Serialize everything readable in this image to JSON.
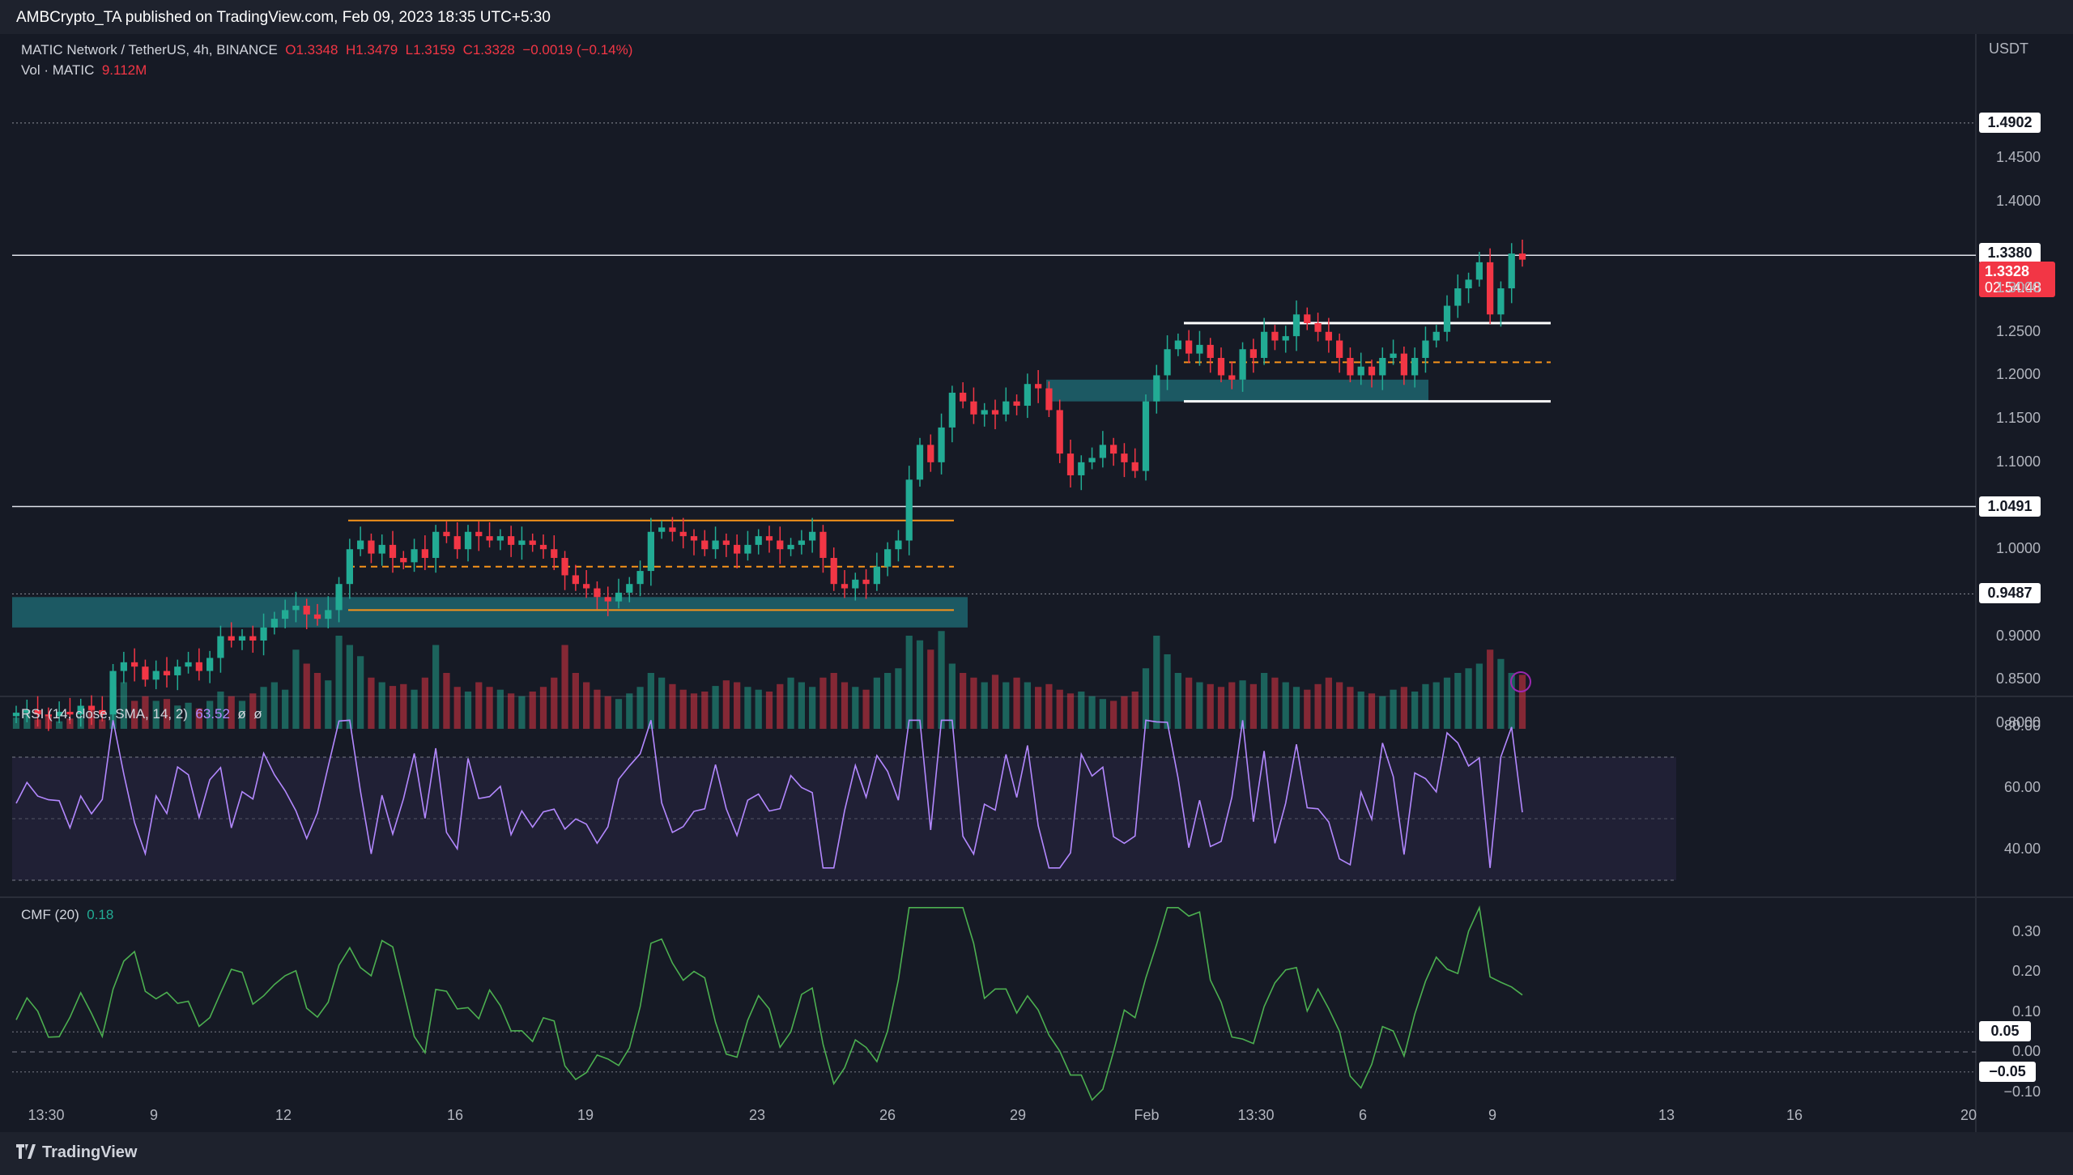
{
  "header": {
    "publisher_line": "AMBCrypto_TA published on TradingView.com, Feb 09, 2023 18:35 UTC+5:30"
  },
  "symbol": {
    "name": "MATIC Network / TetherUS, 4h, BINANCE",
    "open": "O1.3348",
    "high": "H1.3479",
    "low": "L1.3159",
    "close": "C1.3328",
    "change": "−0.0019 (−0.14%)",
    "vol_label": "Vol · MATIC",
    "vol_value": "9.112M",
    "currency": "USDT"
  },
  "price_axis": [
    "1.4500",
    "1.4000",
    "1.3000",
    "1.2500",
    "1.2000",
    "1.1500",
    "1.1000",
    "1.0000",
    "0.9000",
    "0.8500",
    "0.8000"
  ],
  "price_badges": {
    "level_1": "1.4902",
    "level_2": "1.3380",
    "current_price": "1.3328",
    "countdown": "02:54:48",
    "level_3": "1.0491",
    "level_4": "0.9487"
  },
  "rsi": {
    "label": "RSI (14, close, SMA, 14, 2)",
    "value": "63.52",
    "extra1": "ø",
    "extra2": "ø",
    "axis": [
      "80.00",
      "60.00",
      "40.00"
    ]
  },
  "cmf": {
    "label": "CMF (20)",
    "value": "0.18",
    "axis": [
      "0.30",
      "0.20",
      "0.10",
      "0.00",
      "−0.10"
    ],
    "badge_pos": "0.05",
    "badge_neg": "−0.05"
  },
  "time_axis": [
    "13:30",
    "9",
    "12",
    "16",
    "19",
    "23",
    "26",
    "29",
    "Feb",
    "13:30",
    "6",
    "9",
    "13",
    "16",
    "20"
  ],
  "footer": {
    "brand": "TradingView"
  },
  "colors": {
    "up": "#22ab94",
    "down": "#f23645",
    "zone": "#1f6f78",
    "orange": "#f7931a",
    "rsi_line": "#b388ff",
    "cmf_line": "#4caf50"
  },
  "chart_data": {
    "type": "candlestick",
    "title": "MATIC Network / TetherUS, 4h, BINANCE",
    "ylim": [
      0.8,
      1.5
    ],
    "horizontal_levels": [
      1.4902,
      1.338,
      1.0491,
      0.9487
    ],
    "current_price": 1.3328,
    "zones": [
      {
        "name": "demand zone 1",
        "from": 0.91,
        "to": 0.945
      },
      {
        "name": "demand zone 2",
        "from": 1.17,
        "to": 1.195
      }
    ],
    "ranges": [
      {
        "name": "orange range",
        "high": 1.033,
        "mid": 0.98,
        "low": 0.93
      },
      {
        "name": "white range",
        "high": 1.26,
        "mid": 1.215,
        "low": 1.17
      }
    ],
    "price_path": [
      0.812,
      0.815,
      0.81,
      0.808,
      0.813,
      0.81,
      0.82,
      0.815,
      0.81,
      0.86,
      0.87,
      0.865,
      0.85,
      0.86,
      0.855,
      0.865,
      0.87,
      0.86,
      0.875,
      0.9,
      0.895,
      0.9,
      0.895,
      0.91,
      0.92,
      0.93,
      0.935,
      0.925,
      0.92,
      0.93,
      0.96,
      1.0,
      1.01,
      0.995,
      1.005,
      0.99,
      0.985,
      1.0,
      0.99,
      1.02,
      1.015,
      1.0,
      1.02,
      1.015,
      1.01,
      1.015,
      1.005,
      1.01,
      1.005,
      1.0,
      0.99,
      0.97,
      0.96,
      0.955,
      0.945,
      0.94,
      0.95,
      0.96,
      0.975,
      1.02,
      1.025,
      1.02,
      1.015,
      1.01,
      1.0,
      1.01,
      1.005,
      0.995,
      1.005,
      1.015,
      1.01,
      1.0,
      1.005,
      1.01,
      1.02,
      0.99,
      0.96,
      0.955,
      0.965,
      0.96,
      0.98,
      1.0,
      1.01,
      1.08,
      1.12,
      1.1,
      1.14,
      1.18,
      1.17,
      1.155,
      1.16,
      1.155,
      1.17,
      1.165,
      1.19,
      1.185,
      1.16,
      1.11,
      1.085,
      1.1,
      1.105,
      1.12,
      1.11,
      1.1,
      1.09,
      1.17,
      1.2,
      1.23,
      1.24,
      1.225,
      1.235,
      1.22,
      1.2,
      1.195,
      1.23,
      1.22,
      1.25,
      1.24,
      1.245,
      1.27,
      1.26,
      1.25,
      1.24,
      1.22,
      1.2,
      1.21,
      1.2,
      1.22,
      1.225,
      1.2,
      1.22,
      1.24,
      1.25,
      1.28,
      1.3,
      1.31,
      1.33,
      1.27,
      1.3,
      1.34,
      1.333
    ],
    "volume_relative": [
      0.12,
      0.18,
      0.1,
      0.15,
      0.08,
      0.11,
      0.14,
      0.2,
      0.1,
      0.45,
      0.5,
      0.3,
      0.35,
      0.3,
      0.32,
      0.25,
      0.28,
      0.22,
      0.3,
      0.4,
      0.35,
      0.3,
      0.38,
      0.45,
      0.5,
      0.42,
      0.85,
      0.7,
      0.6,
      0.52,
      1.0,
      0.9,
      0.78,
      0.55,
      0.5,
      0.46,
      0.48,
      0.42,
      0.55,
      0.9,
      0.6,
      0.45,
      0.4,
      0.5,
      0.45,
      0.42,
      0.38,
      0.35,
      0.4,
      0.45,
      0.55,
      0.9,
      0.6,
      0.5,
      0.42,
      0.35,
      0.32,
      0.38,
      0.45,
      0.6,
      0.55,
      0.48,
      0.42,
      0.38,
      0.4,
      0.46,
      0.52,
      0.5,
      0.45,
      0.42,
      0.4,
      0.48,
      0.55,
      0.5,
      0.45,
      0.55,
      0.6,
      0.5,
      0.45,
      0.42,
      0.55,
      0.6,
      0.65,
      1.0,
      0.95,
      0.85,
      1.05,
      0.7,
      0.6,
      0.55,
      0.5,
      0.58,
      0.5,
      0.55,
      0.5,
      0.45,
      0.48,
      0.42,
      0.38,
      0.4,
      0.35,
      0.32,
      0.3,
      0.35,
      0.4,
      0.65,
      1.0,
      0.8,
      0.6,
      0.55,
      0.5,
      0.48,
      0.45,
      0.5,
      0.52,
      0.48,
      0.6,
      0.55,
      0.5,
      0.45,
      0.42,
      0.48,
      0.55,
      0.5,
      0.45,
      0.4,
      0.38,
      0.35,
      0.42,
      0.45,
      0.4,
      0.48,
      0.5,
      0.55,
      0.6,
      0.65,
      0.7,
      0.85,
      0.75,
      0.6,
      0.58
    ]
  }
}
